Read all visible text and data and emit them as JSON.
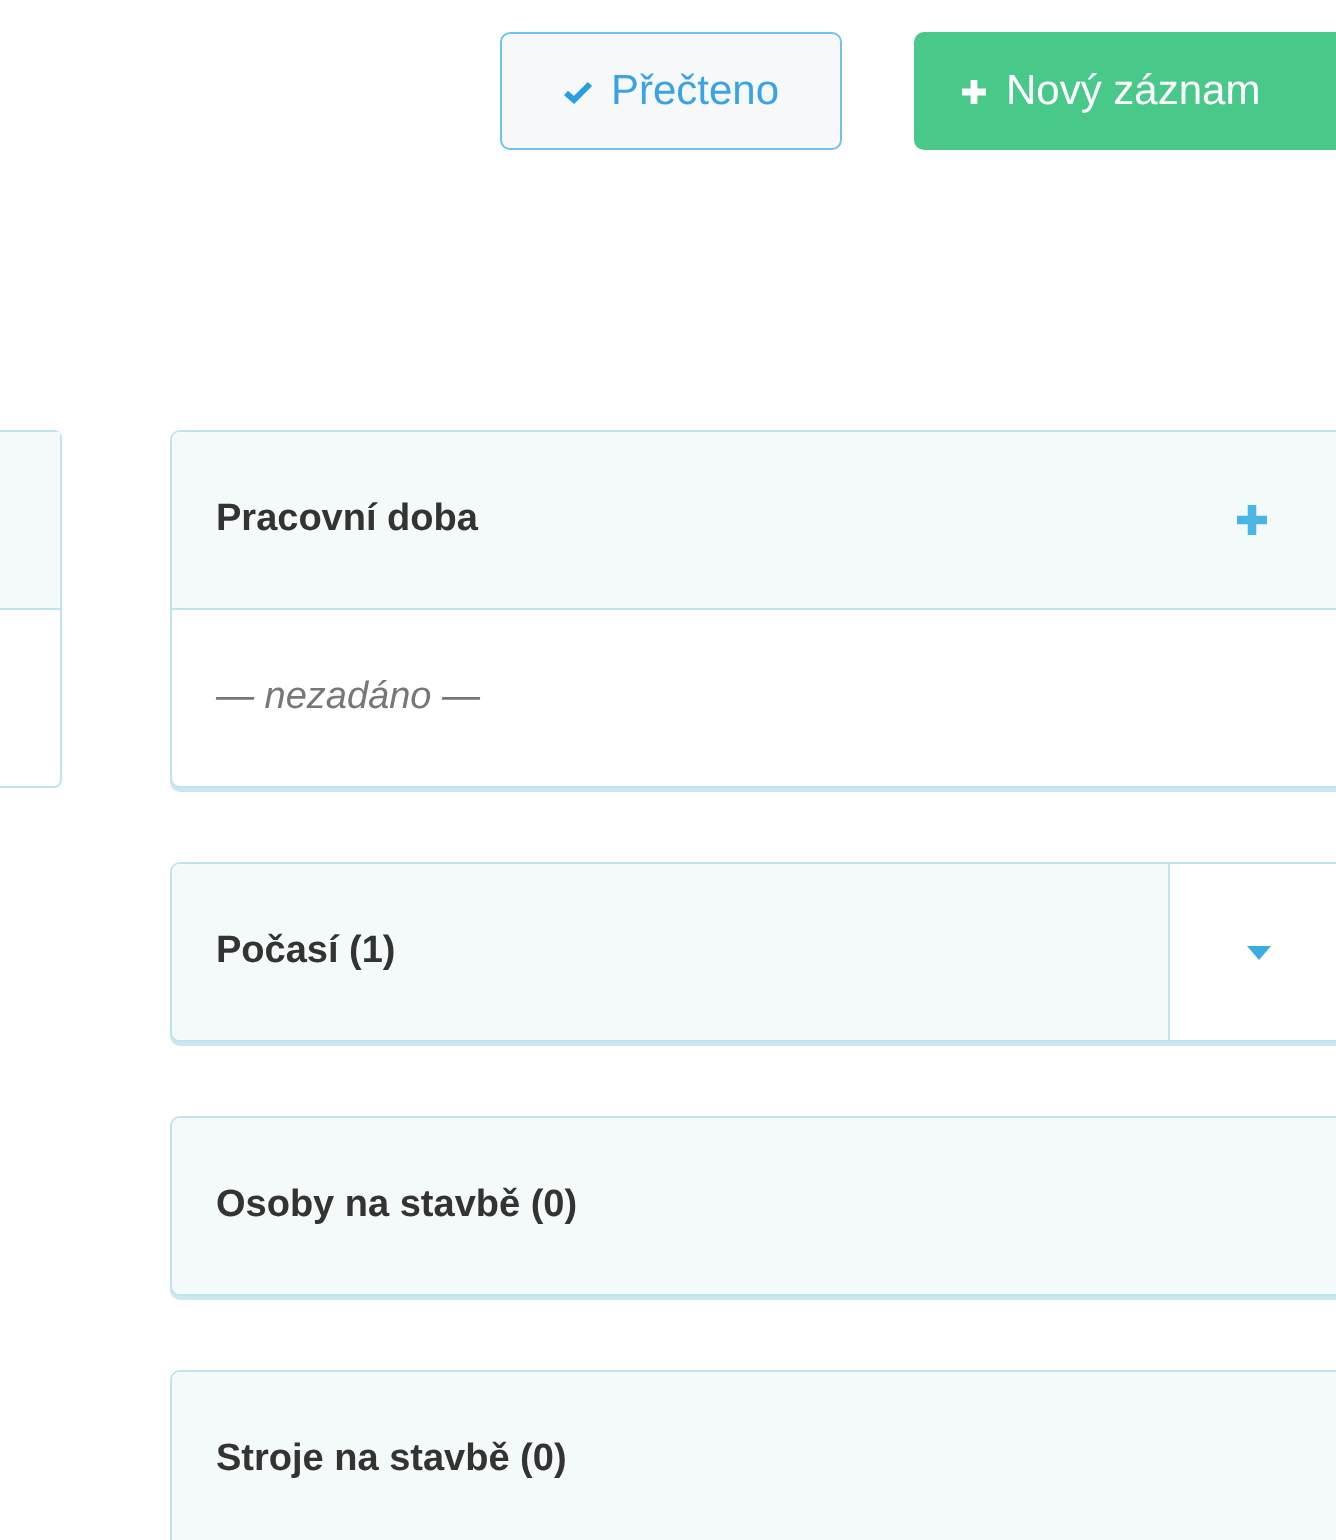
{
  "toolbar": [
    {
      "kind": "outline",
      "label": "Přečteno"
    },
    {
      "kind": "primary",
      "label": "Nový záznam"
    }
  ],
  "panels": [
    {
      "kind": "add",
      "title": "Pracovní doba",
      "body": "— nezadáno —"
    },
    {
      "kind": "dropdown",
      "title": "Počasí (1)"
    },
    {
      "kind": "plain",
      "title": "Osoby na stavbě (0)"
    },
    {
      "kind": "plain",
      "title": "Stroje na stavbě (0)"
    }
  ]
}
